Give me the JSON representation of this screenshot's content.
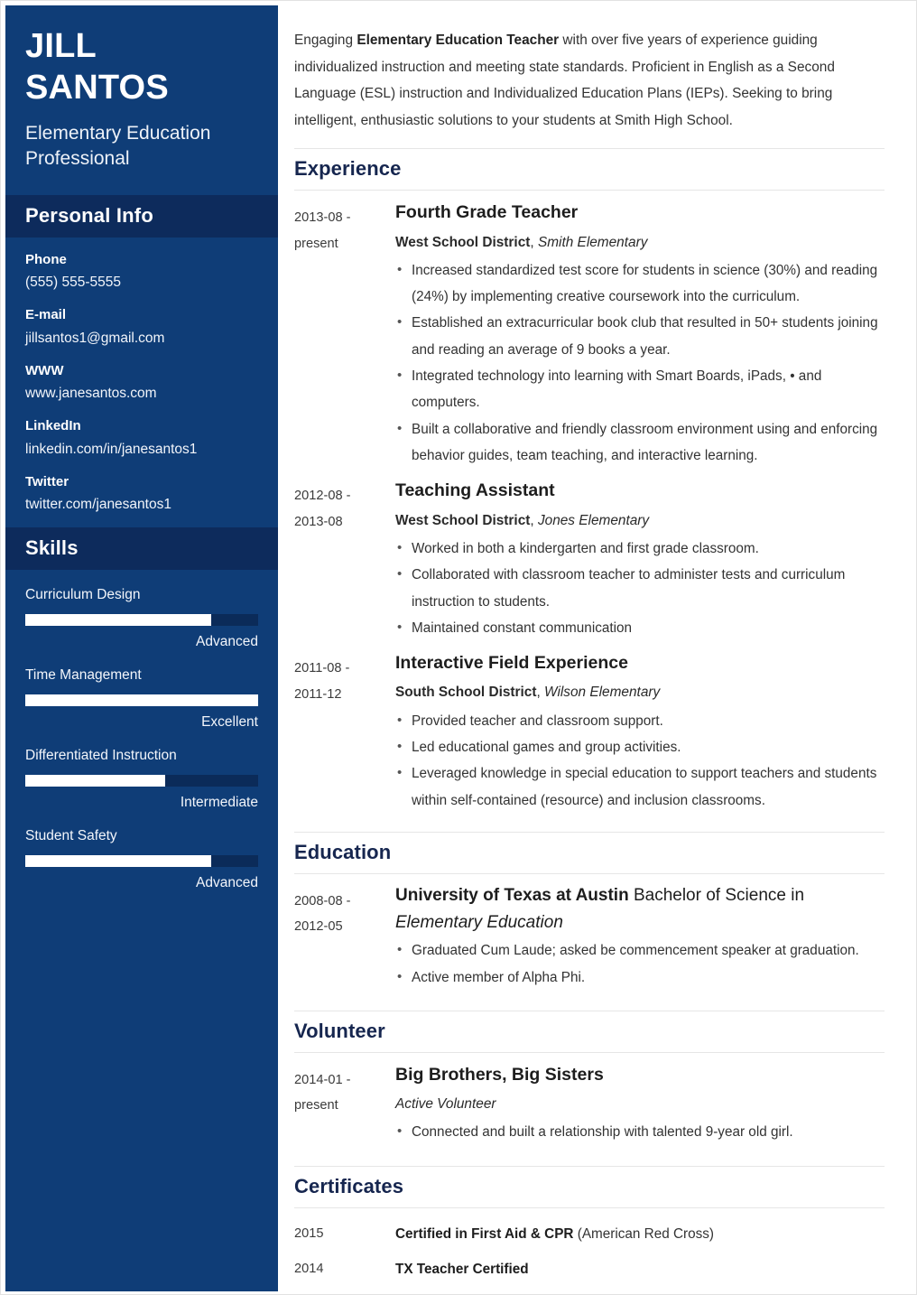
{
  "theme": {
    "sidebar_bg": "#0f3d77",
    "sidebar_band_bg": "#0d2b5c",
    "heading_color": "#16264f",
    "text_color": "#333333",
    "skill_track_bg": "#0b2b59",
    "skill_fill": "#ffffff"
  },
  "sidebar": {
    "first_name": "JILL",
    "last_name": "SANTOS",
    "headline": "Elementary Education Professional",
    "personal_info": {
      "title": "Personal Info",
      "items": [
        {
          "label": "Phone",
          "value": "(555) 555-5555"
        },
        {
          "label": "E-mail",
          "value": "jillsantos1@gmail.com"
        },
        {
          "label": "WWW",
          "value": "www.janesantos.com"
        },
        {
          "label": "LinkedIn",
          "value": "linkedin.com/in/janesantos1"
        },
        {
          "label": "Twitter",
          "value": "twitter.com/janesantos1"
        }
      ]
    },
    "skills": {
      "title": "Skills",
      "items": [
        {
          "name": "Curriculum Design",
          "level": "Advanced",
          "percent": 80
        },
        {
          "name": "Time Management",
          "level": "Excellent",
          "percent": 100
        },
        {
          "name": "Differentiated Instruction",
          "level": "Intermediate",
          "percent": 60
        },
        {
          "name": "Student Safety",
          "level": "Advanced",
          "percent": 80
        }
      ]
    }
  },
  "main": {
    "summary": {
      "part1": "Engaging ",
      "bold": "Elementary Education Teacher",
      "part2": " with over five years of experience guiding individualized instruction and meeting state standards. Proficient in English as a Second Language (ESL) instruction and Individualized Education Plans (IEPs). Seeking to bring intelligent, enthusiastic solutions to your students at Smith High School."
    },
    "experience": {
      "title": "Experience",
      "entries": [
        {
          "date_from": "2013-08 -",
          "date_to": "present",
          "job_title": "Fourth Grade Teacher",
          "org": "West School District",
          "separator": ", ",
          "location": "Smith Elementary",
          "bullets": [
            "Increased standardized test score for students in science (30%) and reading (24%) by implementing creative coursework into the curriculum.",
            "Established an extracurricular book club that resulted in 50+ students joining and reading an average of 9 books a year.",
            "Integrated technology into learning with Smart Boards, iPads, • and computers.",
            "Built a collaborative and friendly classroom environment using and enforcing behavior guides, team teaching, and interactive learning."
          ]
        },
        {
          "date_from": "2012-08 -",
          "date_to": "2013-08",
          "job_title": "Teaching Assistant",
          "org": "West School District",
          "separator": ", ",
          "location": "Jones Elementary",
          "bullets": [
            "Worked in both a kindergarten and first grade classroom.",
            "Collaborated with classroom teacher to administer tests and curriculum instruction to students.",
            "Maintained constant communication"
          ]
        },
        {
          "date_from": "2011-08 -",
          "date_to": "2011-12",
          "job_title": "Interactive Field Experience",
          "org": "South School District",
          "separator": ", ",
          "location": "Wilson Elementary",
          "bullets": [
            "Provided teacher and classroom support.",
            "Led educational games and group activities.",
            "Leveraged knowledge in special education to support teachers and students within self-contained (resource) and inclusion classrooms."
          ]
        }
      ]
    },
    "education": {
      "title": "Education",
      "entries": [
        {
          "date_from": "2008-08 -",
          "date_to": "2012-05",
          "school": "University of Texas at Austin",
          "degree": " Bachelor of Science in ",
          "degree_italic": "Elementary Education",
          "bullets": [
            "Graduated Cum Laude; asked be commencement speaker at graduation.",
            "Active member of Alpha Phi."
          ]
        }
      ]
    },
    "volunteer": {
      "title": "Volunteer",
      "entries": [
        {
          "date_from": "2014-01 -",
          "date_to": "present",
          "org_title": "Big Brothers, Big Sisters",
          "role": "Active Volunteer",
          "bullets": [
            "Connected and built a relationship with talented 9-year old girl."
          ]
        }
      ]
    },
    "certificates": {
      "title": "Certificates",
      "rows": [
        {
          "year": "2015",
          "name": "Certified in First Aid & CPR",
          "issuer": " (American Red Cross)"
        },
        {
          "year": "2014",
          "name": "TX Teacher Certified",
          "issuer": ""
        }
      ]
    }
  }
}
